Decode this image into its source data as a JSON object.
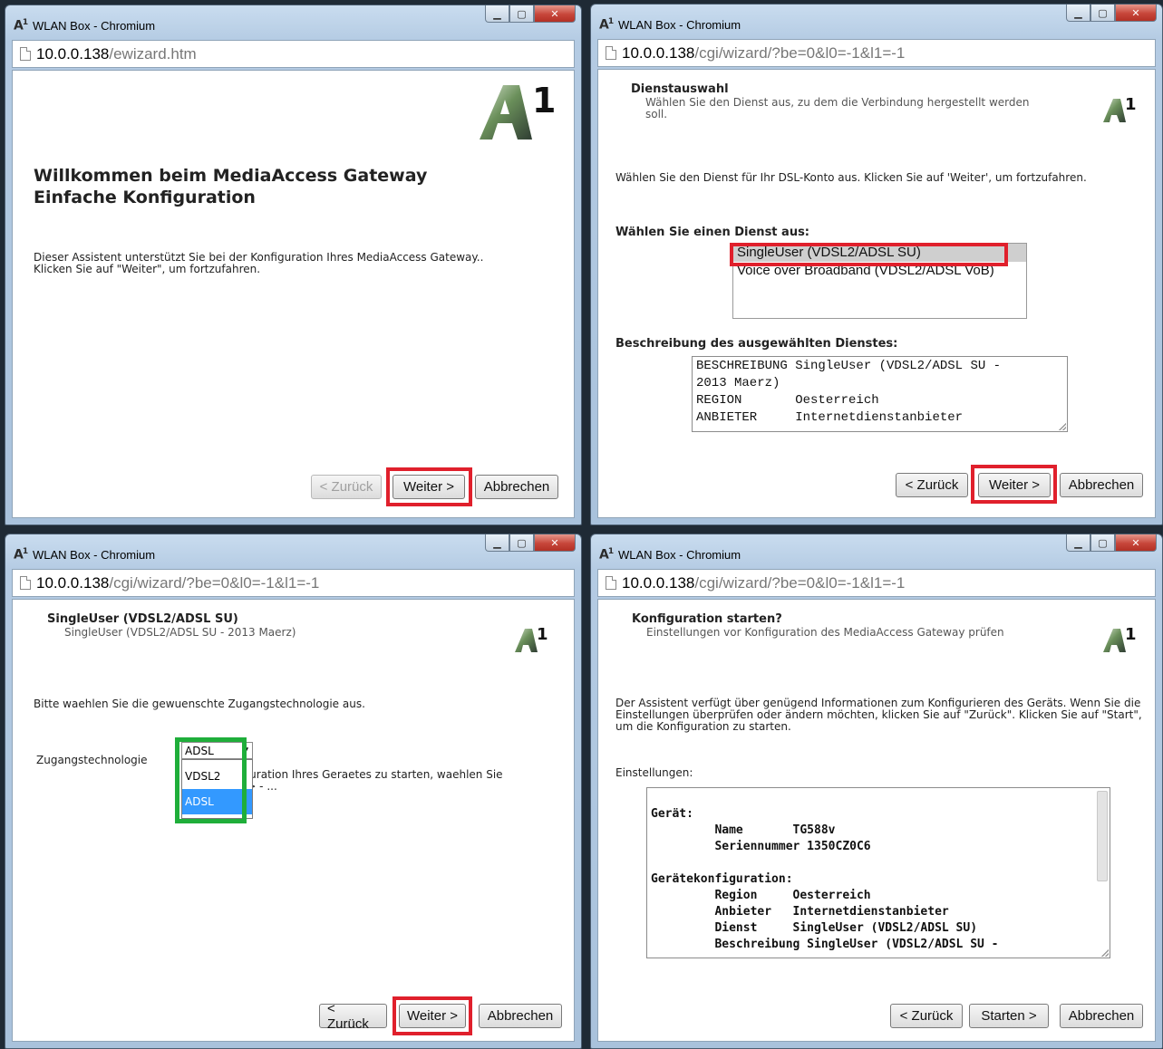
{
  "windows": [
    {
      "title": "WLAN Box - Chromium",
      "url_host": "10.0.0.138",
      "url_path": "/ewizard.htm",
      "heading_line1": "Willkommen beim MediaAccess Gateway",
      "heading_line2": "Einfache Konfiguration",
      "intro_line1": "Dieser Assistent unterstützt Sie bei der Konfiguration Ihres MediaAccess Gateway..",
      "intro_line2": "Klicken Sie auf \"Weiter\", um fortzufahren.",
      "buttons": {
        "back": "< Zurück",
        "next": "Weiter >",
        "cancel": "Abbrechen"
      }
    },
    {
      "title": "WLAN Box - Chromium",
      "url_host": "10.0.0.138",
      "url_path": "/cgi/wizard/?be=0&l0=-1&l1=-1",
      "header_title": "Dienstauswahl",
      "header_sub": "Wählen Sie den Dienst aus, zu dem die Verbindung hergestellt werden soll.",
      "instruction": "Wählen Sie den Dienst für Ihr DSL-Konto aus. Klicken Sie auf 'Weiter', um fortzufahren.",
      "service_label": "Wählen Sie einen Dienst aus:",
      "services": [
        "SingleUser (VDSL2/ADSL SU)",
        "Voice over Broadband (VDSL2/ADSL VoB)"
      ],
      "description_label": "Beschreibung des ausgewählten Dienstes:",
      "description_lines": [
        "BESCHREIBUNG SingleUser (VDSL2/ADSL SU -",
        "2013 Maerz)",
        "REGION       Oesterreich",
        "ANBIETER     Internetdienstanbieter"
      ],
      "buttons": {
        "back": "< Zurück",
        "next": "Weiter >",
        "cancel": "Abbrechen"
      }
    },
    {
      "title": "WLAN Box - Chromium",
      "url_host": "10.0.0.138",
      "url_path": "/cgi/wizard/?be=0&l0=-1&l1=-1",
      "header_title": "SingleUser (VDSL2/ADSL SU)",
      "header_sub": "SingleUser (VDSL2/ADSL SU - 2013 Maerz)",
      "instruction": "Bitte waehlen Sie die gewuenschte Zugangstechnologie aus.",
      "field_label": "Zugangstechnologie",
      "selected": "ADSL",
      "options": [
        "VDSL2",
        "ADSL"
      ],
      "hidden_text_line1": "figuration Ihres Geraetes zu starten, waehlen Sie",
      "hidden_text_line2": "er> - ...",
      "buttons": {
        "back": "< Zurück",
        "next": "Weiter >",
        "cancel": "Abbrechen"
      }
    },
    {
      "title": "WLAN Box - Chromium",
      "url_host": "10.0.0.138",
      "url_path": "/cgi/wizard/?be=0&l0=-1&l1=-1",
      "header_title": "Konfiguration starten?",
      "header_sub": "Einstellungen vor Konfiguration des MediaAccess Gateway prüfen",
      "instruction": "Der Assistent verfügt über genügend Informationen zum Konfigurieren des Geräts. Wenn Sie die Einstellungen überprüfen oder ändern möchten, klicken Sie auf \"Zurück\". Klicken Sie auf \"Start\", um die Konfiguration zu starten.",
      "settings_label": "Einstellungen:",
      "settings_lines": [
        "",
        "Gerät:",
        "         Name       TG588v",
        "         Seriennummer 1350CZ0C6",
        "",
        "Gerätekonfiguration:",
        "         Region     Oesterreich",
        "         Anbieter   Internetdienstanbieter",
        "         Dienst     SingleUser (VDSL2/ADSL SU)",
        "         Beschreibung SingleUser (VDSL2/ADSL SU -"
      ],
      "buttons": {
        "back": "< Zurück",
        "start": "Starten >",
        "cancel": "Abbrechen"
      }
    }
  ]
}
